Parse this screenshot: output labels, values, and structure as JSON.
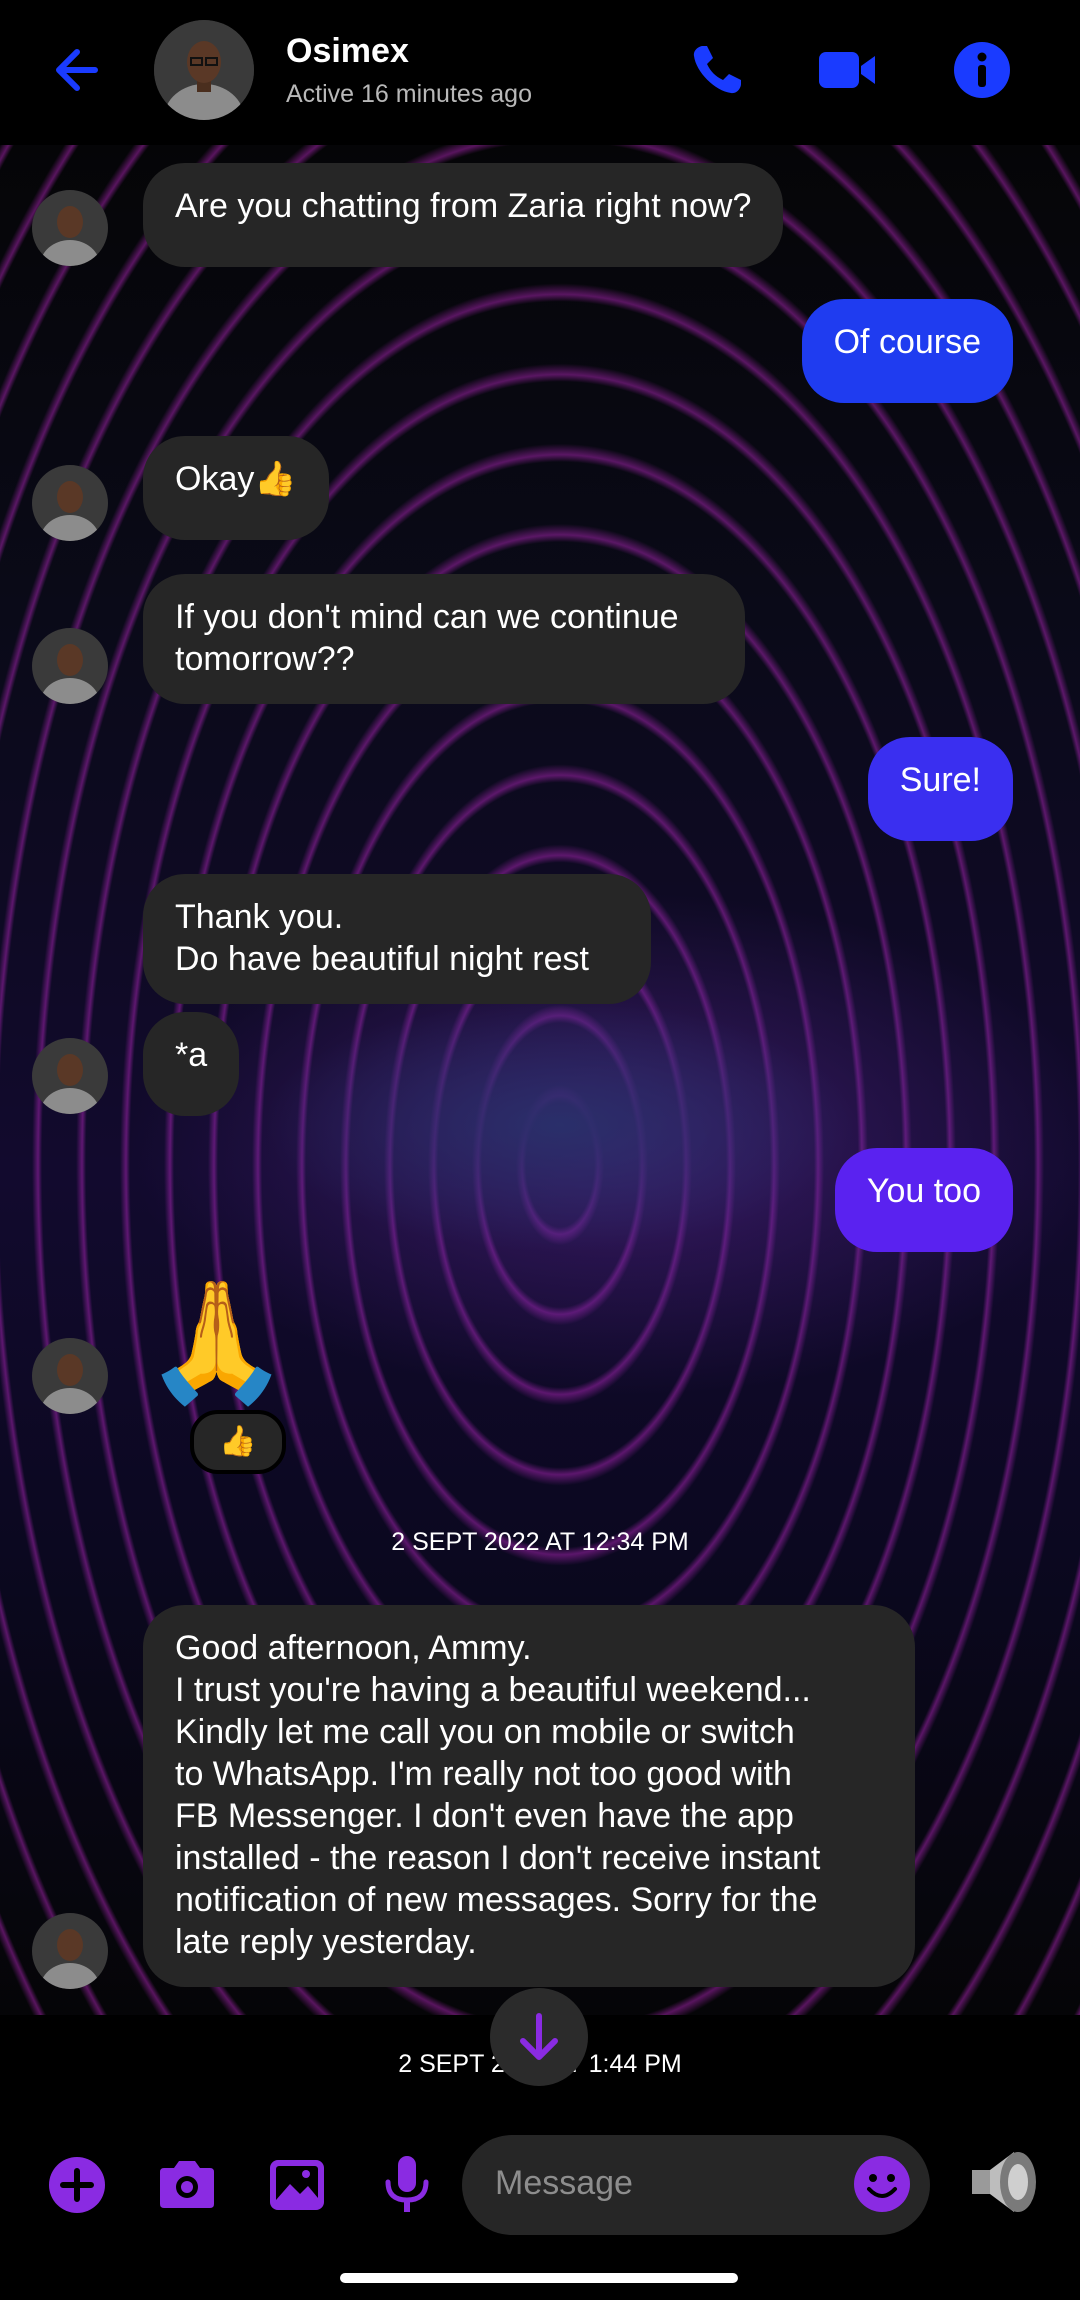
{
  "header": {
    "contact_name": "Osimex",
    "status": "Active 16 minutes ago",
    "back_icon": "arrow-left",
    "call_icon": "phone",
    "video_icon": "video-camera",
    "info_icon": "info"
  },
  "colors": {
    "accent": "#1a3bff",
    "outgoing_1": "#1f3cf0",
    "outgoing_2": "#3a2ff0",
    "outgoing_3": "#5a22f0",
    "composer_icons": "#8a2be2",
    "incoming_bubble": "#262626"
  },
  "messages": [
    {
      "text": "Are you chatting from Zaria right now?"
    },
    {
      "text": "Of course"
    },
    {
      "text": "Okay👍"
    },
    {
      "text": "If you don't mind can we continue\ntomorrow??"
    },
    {
      "text": "Sure!"
    },
    {
      "text": "Thank you.\nDo have beautiful night rest"
    },
    {
      "text": "*a"
    },
    {
      "text": "You too"
    },
    {
      "text": "🙏"
    },
    {
      "reaction": "👍"
    },
    {
      "text": "Good afternoon, Ammy.\nI trust you're having a beautiful weekend...\nKindly let me call you on mobile or switch\nto WhatsApp. I'm really not too good with\nFB Messenger. I don't even have the app\ninstalled - the reason I don't receive instant\nnotification of new messages. Sorry for the\nlate reply yesterday."
    }
  ],
  "timestamps": {
    "first": "2 SEPT 2022 AT 12:34 PM",
    "second": "2 SEPT 2022 AT 1:44 PM"
  },
  "composer": {
    "placeholder": "Message",
    "icons": [
      "plus",
      "camera",
      "image",
      "microphone",
      "emoji",
      "speaker"
    ]
  }
}
